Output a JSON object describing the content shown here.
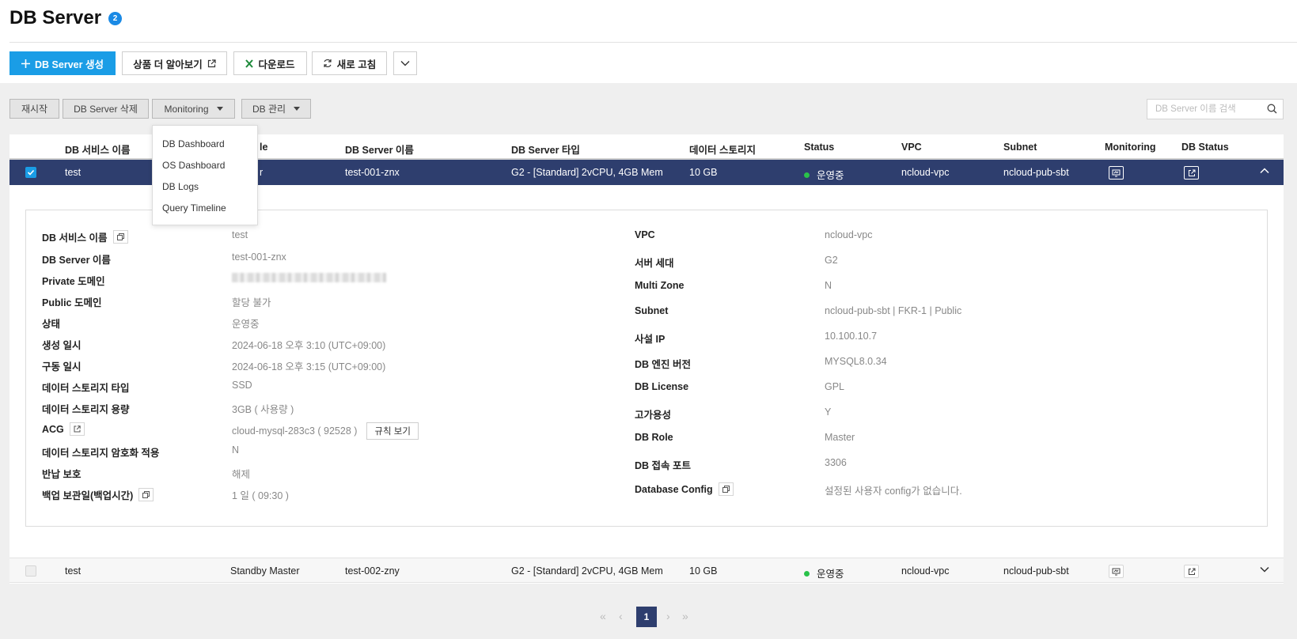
{
  "header": {
    "title": "DB Server",
    "badge": "2"
  },
  "toolbar": {
    "create_label": "DB Server 생성",
    "learn_more_label": "상품 더 알아보기",
    "download_label": "다운로드",
    "refresh_label": "새로 고침"
  },
  "actions": {
    "restart_label": "재시작",
    "delete_label": "DB Server 삭제",
    "monitoring_label": "Monitoring",
    "db_manage_label": "DB 관리"
  },
  "search": {
    "placeholder": "DB Server 이름 검색"
  },
  "monitoring_menu": [
    "DB Dashboard",
    "OS Dashboard",
    "DB Logs",
    "Query Timeline"
  ],
  "table": {
    "columns": {
      "service": "DB 서비스 이름",
      "role": "le",
      "server": "DB Server 이름",
      "type": "DB Server 타입",
      "storage": "데이터 스토리지",
      "status": "Status",
      "vpc": "VPC",
      "subnet": "Subnet",
      "monitoring": "Monitoring",
      "db_status": "DB Status"
    },
    "rows": [
      {
        "service": "test",
        "role": "r",
        "server": "test-001-znx",
        "type": "G2 - [Standard] 2vCPU, 4GB Mem",
        "storage": "10 GB",
        "status": "운영중",
        "vpc": "ncloud-vpc",
        "subnet": "ncloud-pub-sbt",
        "selected": true
      },
      {
        "service": "test",
        "role": "Standby Master",
        "server": "test-002-zny",
        "type": "G2 - [Standard] 2vCPU, 4GB Mem",
        "storage": "10 GB",
        "status": "운영중",
        "vpc": "ncloud-vpc",
        "subnet": "ncloud-pub-sbt",
        "selected": false
      }
    ]
  },
  "detail": {
    "left": [
      {
        "label": "DB 서비스 이름",
        "value": "test"
      },
      {
        "label": "DB Server 이름",
        "value": "test-001-znx"
      },
      {
        "label": "Private 도메인",
        "value": ""
      },
      {
        "label": "Public 도메인",
        "value": "할당 불가"
      },
      {
        "label": "상태",
        "value": "운영중"
      },
      {
        "label": "생성 일시",
        "value": "2024-06-18 오후 3:10 (UTC+09:00)"
      },
      {
        "label": "구동 일시",
        "value": "2024-06-18 오후 3:15 (UTC+09:00)"
      },
      {
        "label": "데이터 스토리지 타입",
        "value": "SSD"
      },
      {
        "label": "데이터 스토리지 용량",
        "value": "3GB ( 사용량 )"
      },
      {
        "label": "ACG",
        "value": "cloud-mysql-283c3 ( 92528 )",
        "button": "규칙 보기"
      },
      {
        "label": "데이터 스토리지 암호화 적용",
        "value": "N"
      },
      {
        "label": "반납 보호",
        "value": "해제"
      },
      {
        "label": "백업 보관일(백업시간)",
        "value": "1 일 ( 09:30 )"
      }
    ],
    "right": [
      {
        "label": "VPC",
        "value": "ncloud-vpc"
      },
      {
        "label": "서버 세대",
        "value": "G2"
      },
      {
        "label": "Multi Zone",
        "value": "N"
      },
      {
        "label": "Subnet",
        "value": "ncloud-pub-sbt | FKR-1 | Public"
      },
      {
        "label": "사설 IP",
        "value": "10.100.10.7"
      },
      {
        "label": "DB 엔진 버전",
        "value": "MYSQL8.0.34"
      },
      {
        "label": "DB License",
        "value": "GPL"
      },
      {
        "label": "고가용성",
        "value": "Y"
      },
      {
        "label": "DB Role",
        "value": "Master"
      },
      {
        "label": "DB 접속 포트",
        "value": "3306"
      },
      {
        "label": "Database Config",
        "value": "설정된 사용자 config가 없습니다."
      }
    ]
  },
  "pagination": {
    "current": "1"
  },
  "colors": {
    "primary": "#1a9de6",
    "selected_row": "#2e3e6e",
    "status_running": "#2ac24a"
  }
}
